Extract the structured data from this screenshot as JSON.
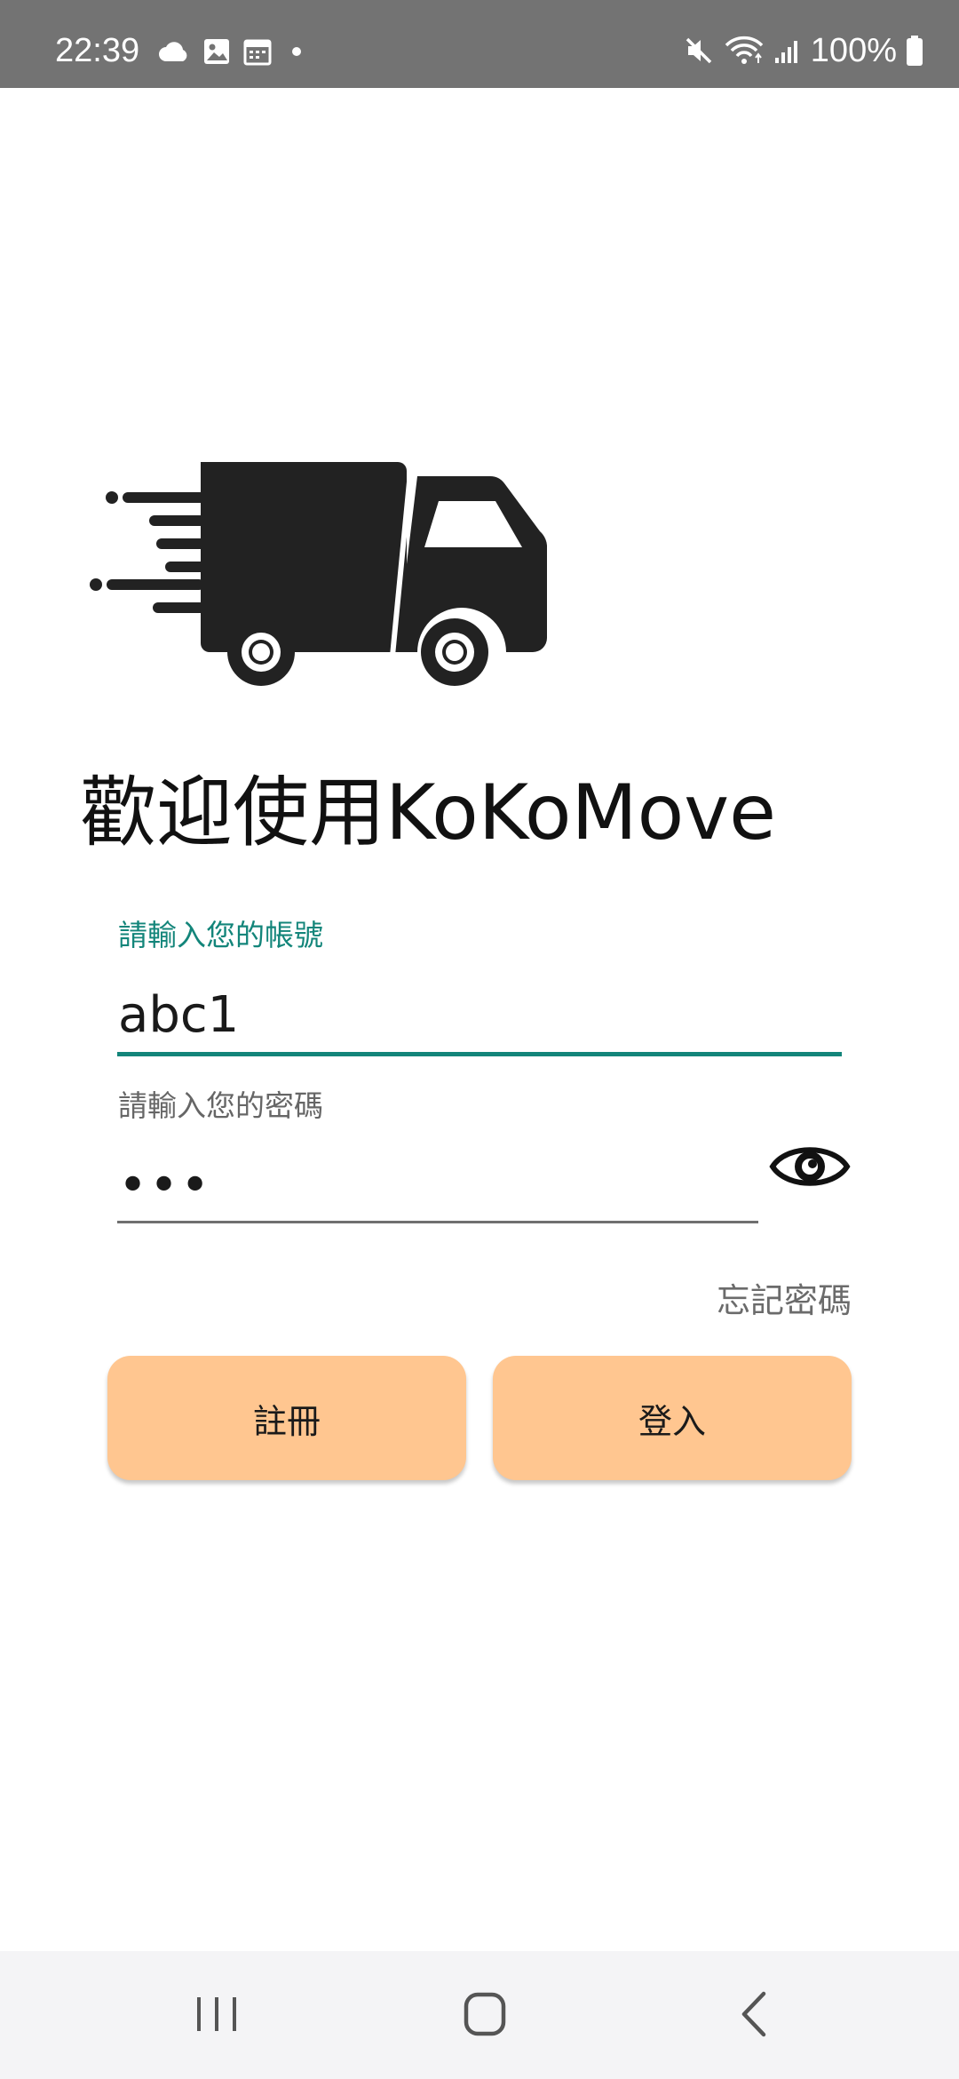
{
  "status_bar": {
    "time": "22:39",
    "battery": "100%",
    "left_icons": [
      "cloud-icon",
      "image-icon",
      "calendar-icon",
      "dot-icon"
    ],
    "right_icons": [
      "mute-icon",
      "wifi-icon",
      "signal-icon",
      "battery-icon"
    ]
  },
  "app": {
    "logo_icon": "delivery-truck-icon",
    "welcome_title": "歡迎使用KoKoMove"
  },
  "login_form": {
    "account_label": "請輸入您的帳號",
    "account_value": "abc1",
    "password_label": "請輸入您的密碼",
    "password_value": "•••",
    "visibility_icon": "eye-icon",
    "forgot_password": "忘記密碼",
    "register_button": "註冊",
    "login_button": "登入"
  },
  "navigation_bar": {
    "buttons": [
      "recents-icon",
      "home-icon",
      "back-icon"
    ]
  },
  "colors": {
    "status_bar_bg": "#737373",
    "accent": "#13857a",
    "button_bg": "#ffc690",
    "nav_bar_bg": "#f4f4f6"
  }
}
